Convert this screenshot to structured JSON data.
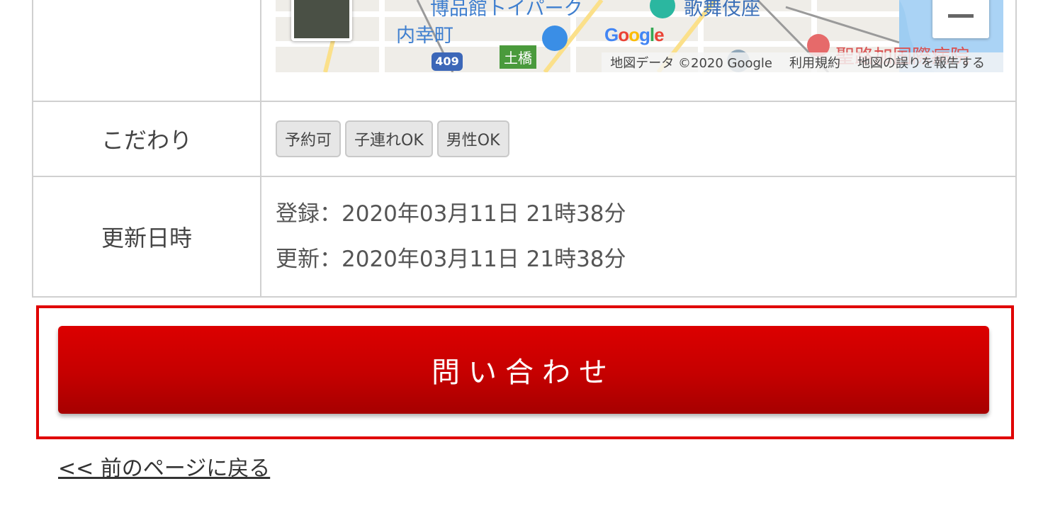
{
  "map": {
    "labels": {
      "museum": "博品館トイパーク",
      "kabuki": "歌舞伎座",
      "uchisaiwai": "内幸町",
      "dobashi": "土橋",
      "route": "409",
      "hospital": "聖路加国際病院"
    },
    "google_logo": "Google",
    "attribution": {
      "map_data": "地図データ ©2020 Google",
      "terms": "利用規約",
      "report": "地図の誤りを報告する"
    }
  },
  "rows": {
    "features": {
      "label": "こだわり",
      "tags": [
        "予約可",
        "子連れOK",
        "男性OK"
      ]
    },
    "updated": {
      "label": "更新日時",
      "registered": "登録：2020年03月11日 21時38分",
      "modified": "更新：2020年03月11日 21時38分"
    }
  },
  "contact": {
    "button_label": "問い合わせ"
  },
  "back_link": "<< 前のページに戻る",
  "colors": {
    "accent_red": "#d40000",
    "frame_red": "#e00000",
    "tag_bg": "#e6e6e6"
  }
}
